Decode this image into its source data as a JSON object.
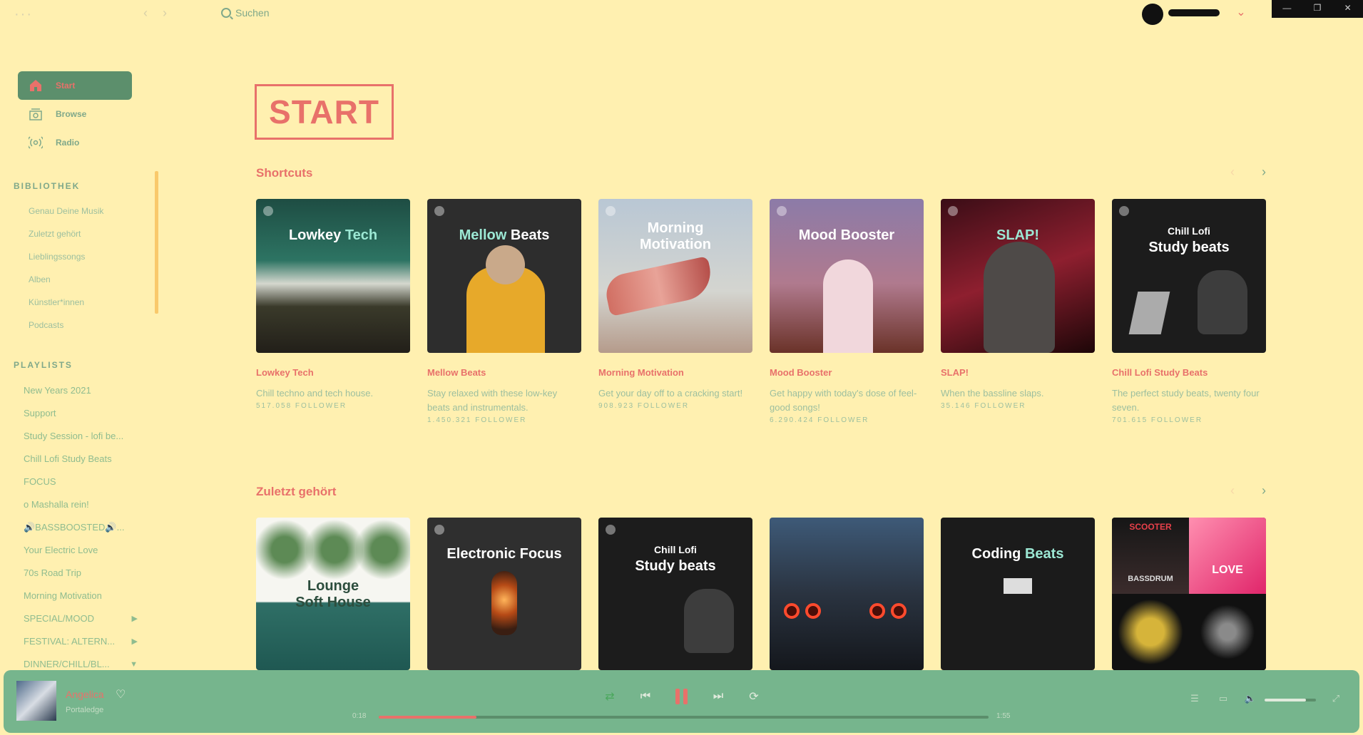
{
  "topbar": {
    "menu_glyph": "···",
    "back_glyph": "‹",
    "forward_glyph": "›",
    "search_label": "Suchen",
    "user_caret": "⌄",
    "window": {
      "minimize": "—",
      "restore": "❐",
      "close": "✕"
    }
  },
  "sidebar": {
    "nav": [
      {
        "label": "Start",
        "icon": "home-icon"
      },
      {
        "label": "Browse",
        "icon": "browse-icon"
      },
      {
        "label": "Radio",
        "icon": "radio-icon"
      }
    ],
    "library_heading": "BIBLIOTHEK",
    "library": [
      "Genau Deine Musik",
      "Zuletzt gehört",
      "Lieblingssongs",
      "Alben",
      "Künstler*innen",
      "Podcasts"
    ],
    "playlists_heading": "PLAYLISTS",
    "playlists": [
      "New Years 2021",
      "Support",
      "Study Session - lofi be...",
      "Chill Lofi Study Beats",
      "FOCUS",
      "o  Mashalla rein!",
      "🔊BASSBOOSTED🔊...",
      "Your Electric Love",
      "70s Road Trip",
      "Morning Motivation",
      "SPECIAL/MOOD",
      "FESTIVAL: ALTERN...",
      "DINNER/CHILL/BL..."
    ],
    "folder_arrow": "▶",
    "folder_open_arrow": "▼"
  },
  "main": {
    "page_title": "START",
    "arrow_left": "‹",
    "arrow_right": "›",
    "shortcuts_title": "Shortcuts",
    "shortcuts": [
      {
        "cover_line1": "Lowkey ",
        "cover_accent": "Tech",
        "name": "Lowkey Tech",
        "desc": "Chill techno and tech house.",
        "followers": "517.058 FOLLOWER"
      },
      {
        "cover_line1": "Mellow ",
        "cover_accent": "Beats",
        "name": "Mellow Beats",
        "desc": "Stay relaxed with these low-key beats and instrumentals.",
        "followers": "1.450.321 FOLLOWER"
      },
      {
        "cover_line1": "Morning",
        "cover_accent": "Motivation",
        "name": "Morning Motivation",
        "desc": "Get your day off to a cracking start!",
        "followers": "908.923 FOLLOWER"
      },
      {
        "cover_line1": "Mood Booster",
        "cover_accent": "",
        "name": "Mood Booster",
        "desc": "Get happy with today's dose of feel-good songs!",
        "followers": "6.290.424 FOLLOWER"
      },
      {
        "cover_line1": "SLAP!",
        "cover_accent": "",
        "name": "SLAP!",
        "desc": "When the bassline slaps.",
        "followers": "35.146 FOLLOWER"
      },
      {
        "cover_line1": "Chill Lofi",
        "cover_accent": "Study beats",
        "name": "Chill Lofi Study Beats",
        "desc": "The perfect study beats, twenty four seven.",
        "followers": "701.615 FOLLOWER"
      }
    ],
    "recent_title": "Zuletzt gehört",
    "recent": [
      {
        "cover_line1": "Lounge",
        "cover_accent": "Soft House"
      },
      {
        "cover_line1": "Electronic Focus",
        "cover_accent": ""
      },
      {
        "cover_line1": "Chill Lofi",
        "cover_accent": "Study beats"
      },
      {
        "cover_line1": "",
        "cover_accent": ""
      },
      {
        "cover_line1": "Coding ",
        "cover_accent": "Beats"
      },
      {
        "cover_line1": "SCOOTER",
        "cover_accent": "BASSDRUM",
        "cover_extra": "LOVE"
      }
    ]
  },
  "player": {
    "track": "Angelica",
    "artist": "Portaledge",
    "heart": "♡",
    "elapsed": "0:18",
    "duration": "1:55",
    "progress_fraction": 0.16,
    "volume_fraction": 0.8,
    "icons": {
      "shuffle": "⇄",
      "prev": "⏮",
      "next": "⏭",
      "repeat": "⟳",
      "queue": "☰",
      "devices": "▭",
      "volume": "🔈",
      "fullscreen": "⤢"
    }
  },
  "colors": {
    "background": "#fff0b0",
    "accent": "#e8716a",
    "green": "#76b58d"
  }
}
